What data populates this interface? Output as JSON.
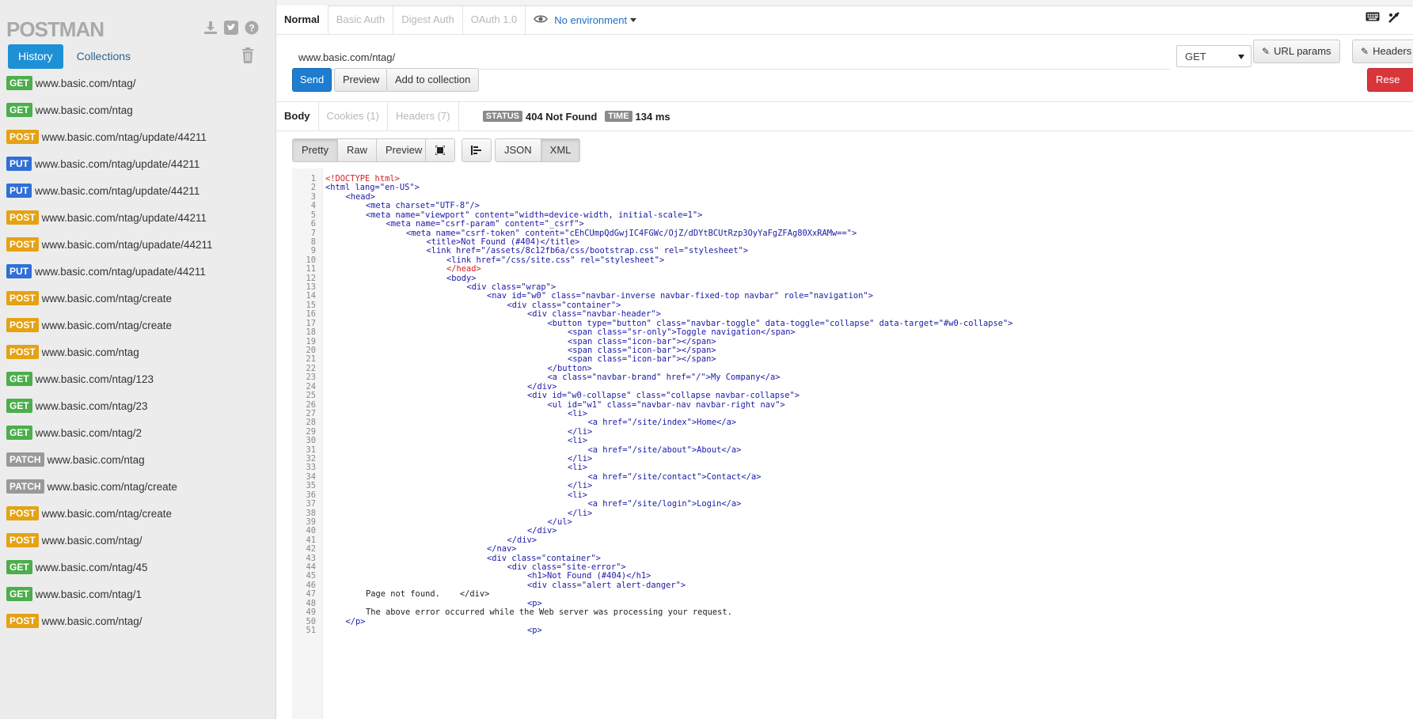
{
  "app": {
    "logo": "POSTMAN"
  },
  "sidebar": {
    "tabs": [
      {
        "label": "History",
        "active": true
      },
      {
        "label": "Collections",
        "active": false
      }
    ],
    "history": [
      {
        "method": "GET",
        "url": "www.basic.com/ntag/"
      },
      {
        "method": "GET",
        "url": "www.basic.com/ntag"
      },
      {
        "method": "POST",
        "url": "www.basic.com/ntag/update/44211"
      },
      {
        "method": "PUT",
        "url": "www.basic.com/ntag/update/44211"
      },
      {
        "method": "PUT",
        "url": "www.basic.com/ntag/update/44211"
      },
      {
        "method": "POST",
        "url": "www.basic.com/ntag/update/44211"
      },
      {
        "method": "POST",
        "url": "www.basic.com/ntag/upadate/44211"
      },
      {
        "method": "PUT",
        "url": "www.basic.com/ntag/upadate/44211"
      },
      {
        "method": "POST",
        "url": "www.basic.com/ntag/create"
      },
      {
        "method": "POST",
        "url": "www.basic.com/ntag/create"
      },
      {
        "method": "POST",
        "url": "www.basic.com/ntag"
      },
      {
        "method": "GET",
        "url": "www.basic.com/ntag/123"
      },
      {
        "method": "GET",
        "url": "www.basic.com/ntag/23"
      },
      {
        "method": "GET",
        "url": "www.basic.com/ntag/2"
      },
      {
        "method": "PATCH",
        "url": "www.basic.com/ntag"
      },
      {
        "method": "PATCH",
        "url": "www.basic.com/ntag/create"
      },
      {
        "method": "POST",
        "url": "www.basic.com/ntag/create"
      },
      {
        "method": "POST",
        "url": "www.basic.com/ntag/"
      },
      {
        "method": "GET",
        "url": "www.basic.com/ntag/45"
      },
      {
        "method": "GET",
        "url": "www.basic.com/ntag/1"
      },
      {
        "method": "POST",
        "url": "www.basic.com/ntag/"
      }
    ]
  },
  "method_colors": {
    "GET": "#4cae4c",
    "POST": "#e5a213",
    "PUT": "#2f6fd6",
    "PATCH": "#999999"
  },
  "auth_tabs": [
    {
      "label": "Normal",
      "active": true
    },
    {
      "label": "Basic Auth",
      "active": false
    },
    {
      "label": "Digest Auth",
      "active": false
    },
    {
      "label": "OAuth 1.0",
      "active": false
    }
  ],
  "environment": {
    "label": "No environment"
  },
  "request": {
    "url": "www.basic.com/ntag/",
    "method": "GET",
    "url_params_label": "URL params",
    "headers_label": "Headers (",
    "send_label": "Send",
    "preview_label": "Preview",
    "add_collection_label": "Add to collection",
    "reset_label": "Rese"
  },
  "response": {
    "tabs": [
      {
        "label": "Body",
        "active": true
      },
      {
        "label": "Cookies (1)",
        "active": false
      },
      {
        "label": "Headers (7)",
        "active": false
      }
    ],
    "status_label": "STATUS",
    "status_value": "404 Not Found",
    "time_label": "TIME",
    "time_value": "134 ms",
    "view_modes": [
      {
        "label": "Pretty",
        "active": true
      },
      {
        "label": "Raw",
        "active": false
      },
      {
        "label": "Preview",
        "active": false
      }
    ],
    "formats": [
      {
        "label": "JSON",
        "active": false
      },
      {
        "label": "XML",
        "active": true
      }
    ]
  },
  "code_lines": [
    {
      "n": "1",
      "indent": 0,
      "text": "<!DOCTYPE html>",
      "cls": "t-red"
    },
    {
      "n": "2",
      "indent": 0,
      "text": "<html lang=\"en-US\">",
      "cls": "t-tag"
    },
    {
      "n": "3",
      "indent": 1,
      "text": "<head>",
      "cls": "t-tag"
    },
    {
      "n": "4",
      "indent": 2,
      "text": "<meta charset=\"UTF-8\"/>",
      "cls": "t-tag"
    },
    {
      "n": "5",
      "indent": 2,
      "text": "<meta name=\"viewport\" content=\"width=device-width, initial-scale=1\">",
      "cls": "t-tag"
    },
    {
      "n": "6",
      "indent": 3,
      "text": "<meta name=\"csrf-param\" content=\"_csrf\">",
      "cls": "t-tag"
    },
    {
      "n": "7",
      "indent": 4,
      "text": "<meta name=\"csrf-token\" content=\"cEhCUmpQdGwjIC4FGWc/OjZ/dDYtBCUtRzp3OyYaFgZFAg80XxRAMw==\">",
      "cls": "t-tag"
    },
    {
      "n": "8",
      "indent": 5,
      "text": "<title>Not Found (#404)</title>",
      "cls": "t-tag"
    },
    {
      "n": "9",
      "indent": 5,
      "text": "<link href=\"/assets/8c12fb6a/css/bootstrap.css\" rel=\"stylesheet\">",
      "cls": "t-tag"
    },
    {
      "n": "10",
      "indent": 6,
      "text": "<link href=\"/css/site.css\" rel=\"stylesheet\">",
      "cls": "t-tag"
    },
    {
      "n": "11",
      "indent": 6,
      "text": "</head>",
      "cls": "t-red"
    },
    {
      "n": "12",
      "indent": 6,
      "text": "<body>",
      "cls": "t-tag"
    },
    {
      "n": "13",
      "indent": 7,
      "text": "<div class=\"wrap\">",
      "cls": "t-tag"
    },
    {
      "n": "14",
      "indent": 8,
      "text": "<nav id=\"w0\" class=\"navbar-inverse navbar-fixed-top navbar\" role=\"navigation\">",
      "cls": "t-tag"
    },
    {
      "n": "15",
      "indent": 9,
      "text": "<div class=\"container\">",
      "cls": "t-tag"
    },
    {
      "n": "16",
      "indent": 10,
      "text": "<div class=\"navbar-header\">",
      "cls": "t-tag"
    },
    {
      "n": "17",
      "indent": 11,
      "text": "<button type=\"button\" class=\"navbar-toggle\" data-toggle=\"collapse\" data-target=\"#w0-collapse\">",
      "cls": "t-tag"
    },
    {
      "n": "18",
      "indent": 12,
      "text": "<span class=\"sr-only\">Toggle navigation</span>",
      "cls": "t-tag"
    },
    {
      "n": "19",
      "indent": 12,
      "text": "<span class=\"icon-bar\"></span>",
      "cls": "t-tag"
    },
    {
      "n": "20",
      "indent": 12,
      "text": "<span class=\"icon-bar\"></span>",
      "cls": "t-tag"
    },
    {
      "n": "21",
      "indent": 12,
      "text": "<span class=\"icon-bar\"></span>",
      "cls": "t-tag"
    },
    {
      "n": "22",
      "indent": 11,
      "text": "</button>",
      "cls": "t-tag"
    },
    {
      "n": "23",
      "indent": 11,
      "text": "<a class=\"navbar-brand\" href=\"/\">My Company</a>",
      "cls": "t-tag"
    },
    {
      "n": "24",
      "indent": 10,
      "text": "</div>",
      "cls": "t-tag"
    },
    {
      "n": "25",
      "indent": 10,
      "text": "<div id=\"w0-collapse\" class=\"collapse navbar-collapse\">",
      "cls": "t-tag"
    },
    {
      "n": "26",
      "indent": 11,
      "text": "<ul id=\"w1\" class=\"navbar-nav navbar-right nav\">",
      "cls": "t-tag"
    },
    {
      "n": "27",
      "indent": 12,
      "text": "<li>",
      "cls": "t-tag"
    },
    {
      "n": "28",
      "indent": 13,
      "text": "<a href=\"/site/index\">Home</a>",
      "cls": "t-tag"
    },
    {
      "n": "29",
      "indent": 12,
      "text": "</li>",
      "cls": "t-tag"
    },
    {
      "n": "30",
      "indent": 12,
      "text": "<li>",
      "cls": "t-tag"
    },
    {
      "n": "31",
      "indent": 13,
      "text": "<a href=\"/site/about\">About</a>",
      "cls": "t-tag"
    },
    {
      "n": "32",
      "indent": 12,
      "text": "</li>",
      "cls": "t-tag"
    },
    {
      "n": "33",
      "indent": 12,
      "text": "<li>",
      "cls": "t-tag"
    },
    {
      "n": "34",
      "indent": 13,
      "text": "<a href=\"/site/contact\">Contact</a>",
      "cls": "t-tag"
    },
    {
      "n": "35",
      "indent": 12,
      "text": "</li>",
      "cls": "t-tag"
    },
    {
      "n": "36",
      "indent": 12,
      "text": "<li>",
      "cls": "t-tag"
    },
    {
      "n": "37",
      "indent": 13,
      "text": "<a href=\"/site/login\">Login</a>",
      "cls": "t-tag"
    },
    {
      "n": "38",
      "indent": 12,
      "text": "</li>",
      "cls": "t-tag"
    },
    {
      "n": "39",
      "indent": 11,
      "text": "</ul>",
      "cls": "t-tag"
    },
    {
      "n": "40",
      "indent": 10,
      "text": "</div>",
      "cls": "t-tag"
    },
    {
      "n": "41",
      "indent": 9,
      "text": "</div>",
      "cls": "t-tag"
    },
    {
      "n": "42",
      "indent": 8,
      "text": "</nav>",
      "cls": "t-tag"
    },
    {
      "n": "43",
      "indent": 8,
      "text": "<div class=\"container\">",
      "cls": "t-tag"
    },
    {
      "n": "44",
      "indent": 9,
      "text": "<div class=\"site-error\">",
      "cls": "t-tag"
    },
    {
      "n": "45",
      "indent": 10,
      "text": "<h1>Not Found (#404)</h1>",
      "cls": "t-tag"
    },
    {
      "n": "46",
      "indent": 10,
      "text": "<div class=\"alert alert-danger\">",
      "cls": "t-tag"
    },
    {
      "n": "47",
      "indent": 2,
      "text": "Page not found.    </div>",
      "cls": "t-plain"
    },
    {
      "n": "48",
      "indent": 10,
      "text": "<p>",
      "cls": "t-tag"
    },
    {
      "n": "49",
      "indent": 2,
      "text": "The above error occurred while the Web server was processing your request.",
      "cls": "t-plain"
    },
    {
      "n": "50",
      "indent": 1,
      "text": "</p>",
      "cls": "t-tag"
    },
    {
      "n": "51",
      "indent": 10,
      "text": "<p>",
      "cls": "t-tag"
    }
  ]
}
